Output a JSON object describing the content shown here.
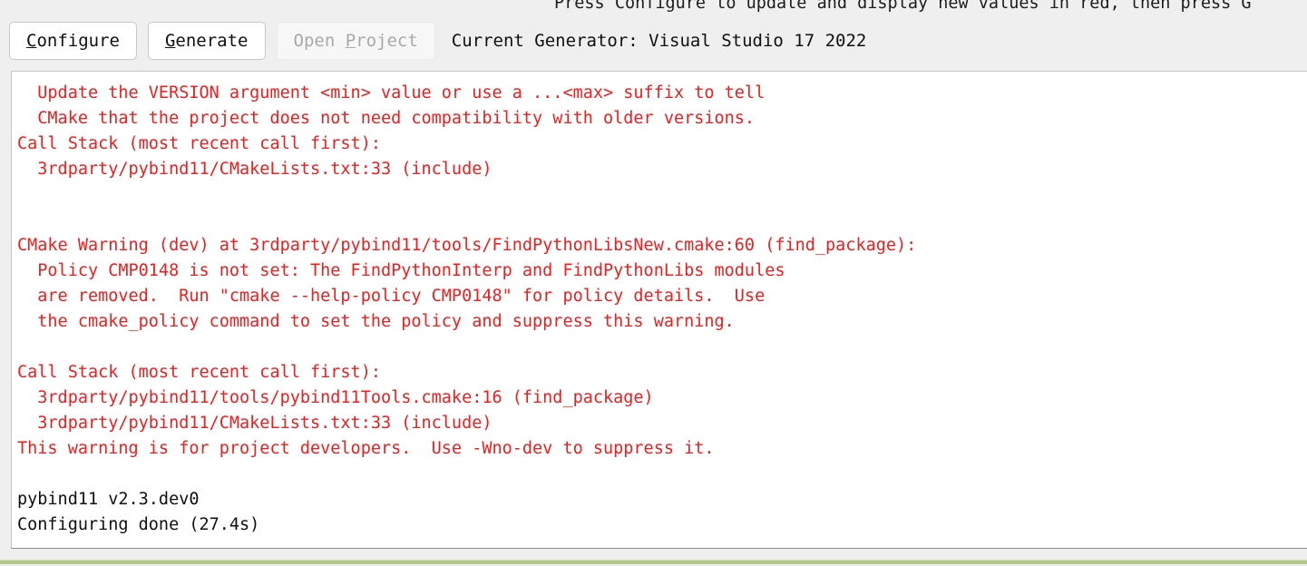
{
  "status_top": {
    "text": "Press Configure to update and display new values in red, then press G"
  },
  "toolbar": {
    "configure": {
      "mnemonic": "C",
      "rest": "onfigure"
    },
    "generate": {
      "mnemonic": "G",
      "rest": "enerate"
    },
    "open_project": {
      "pre": "Open ",
      "mnemonic": "P",
      "rest": "roject"
    },
    "generator_label": "Current Generator: Visual Studio 17 2022"
  },
  "output": {
    "lines": [
      {
        "text": "  Update the VERSION argument <min> value or use a ...<max> suffix to tell",
        "color": "red"
      },
      {
        "text": "  CMake that the project does not need compatibility with older versions.",
        "color": "red"
      },
      {
        "text": "Call Stack (most recent call first):",
        "color": "red"
      },
      {
        "text": "  3rdparty/pybind11/CMakeLists.txt:33 (include)",
        "color": "red"
      },
      {
        "text": "",
        "color": "red"
      },
      {
        "text": "",
        "color": "red"
      },
      {
        "text": "CMake Warning (dev) at 3rdparty/pybind11/tools/FindPythonLibsNew.cmake:60 (find_package):",
        "color": "red"
      },
      {
        "text": "  Policy CMP0148 is not set: The FindPythonInterp and FindPythonLibs modules",
        "color": "red"
      },
      {
        "text": "  are removed.  Run \"cmake --help-policy CMP0148\" for policy details.  Use",
        "color": "red"
      },
      {
        "text": "  the cmake_policy command to set the policy and suppress this warning.",
        "color": "red"
      },
      {
        "text": "",
        "color": "red"
      },
      {
        "text": "Call Stack (most recent call first):",
        "color": "red"
      },
      {
        "text": "  3rdparty/pybind11/tools/pybind11Tools.cmake:16 (find_package)",
        "color": "red"
      },
      {
        "text": "  3rdparty/pybind11/CMakeLists.txt:33 (include)",
        "color": "red"
      },
      {
        "text": "This warning is for project developers.  Use -Wno-dev to suppress it.",
        "color": "red"
      },
      {
        "text": "",
        "color": "black"
      },
      {
        "text": "pybind11 v2.3.dev0",
        "color": "black"
      },
      {
        "text": "Configuring done (27.4s)",
        "color": "black"
      }
    ]
  },
  "colors": {
    "warning_red": "#ef1d1d",
    "text_black": "#101010",
    "chrome_background": "#efefef",
    "panel_background": "#ffffff",
    "progress_green": "#b5ca86"
  }
}
